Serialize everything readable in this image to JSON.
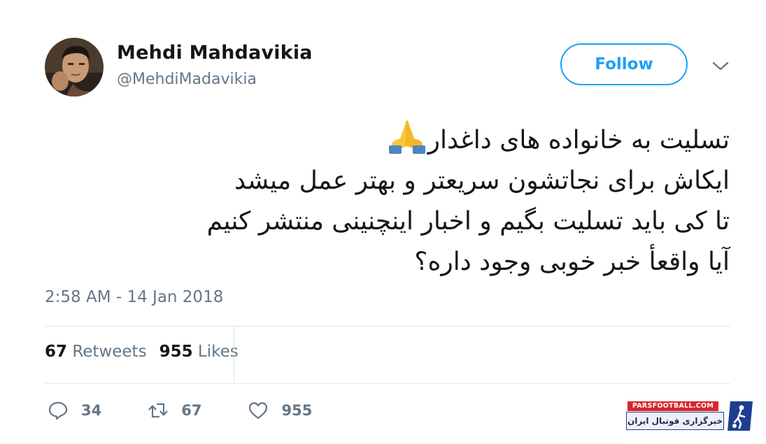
{
  "user": {
    "display_name": "Mehdi Mahdavikia",
    "handle": "@MehdiMadavikia"
  },
  "follow_button": {
    "label": "Follow"
  },
  "tweet": {
    "lines": [
      "تسلیت به خانواده های داغدار",
      "ایکاش برای نجاتشون سریعتر و بهتر عمل میشد",
      "تا کی باید تسلیت بگیم و اخبار اینچنینی منتشر کنیم",
      "آیا واقعأ خبر خوبی وجود داره؟"
    ],
    "emoji": "folded-hands"
  },
  "timestamp": "2:58 AM - 14 Jan 2018",
  "stats": {
    "retweets_count": "67",
    "retweets_label": "Retweets",
    "likes_count": "955",
    "likes_label": "Likes"
  },
  "actions": {
    "reply_count": "34",
    "retweet_count": "67",
    "like_count": "955"
  },
  "watermark": {
    "brand": "PARSFOOTBALL.COM",
    "tagline": "خبرگزاری فوتبال ایران"
  },
  "colors": {
    "accent": "#1da1f2",
    "text": "#14171a",
    "secondary": "#657786",
    "divider": "#e1e8ed"
  }
}
